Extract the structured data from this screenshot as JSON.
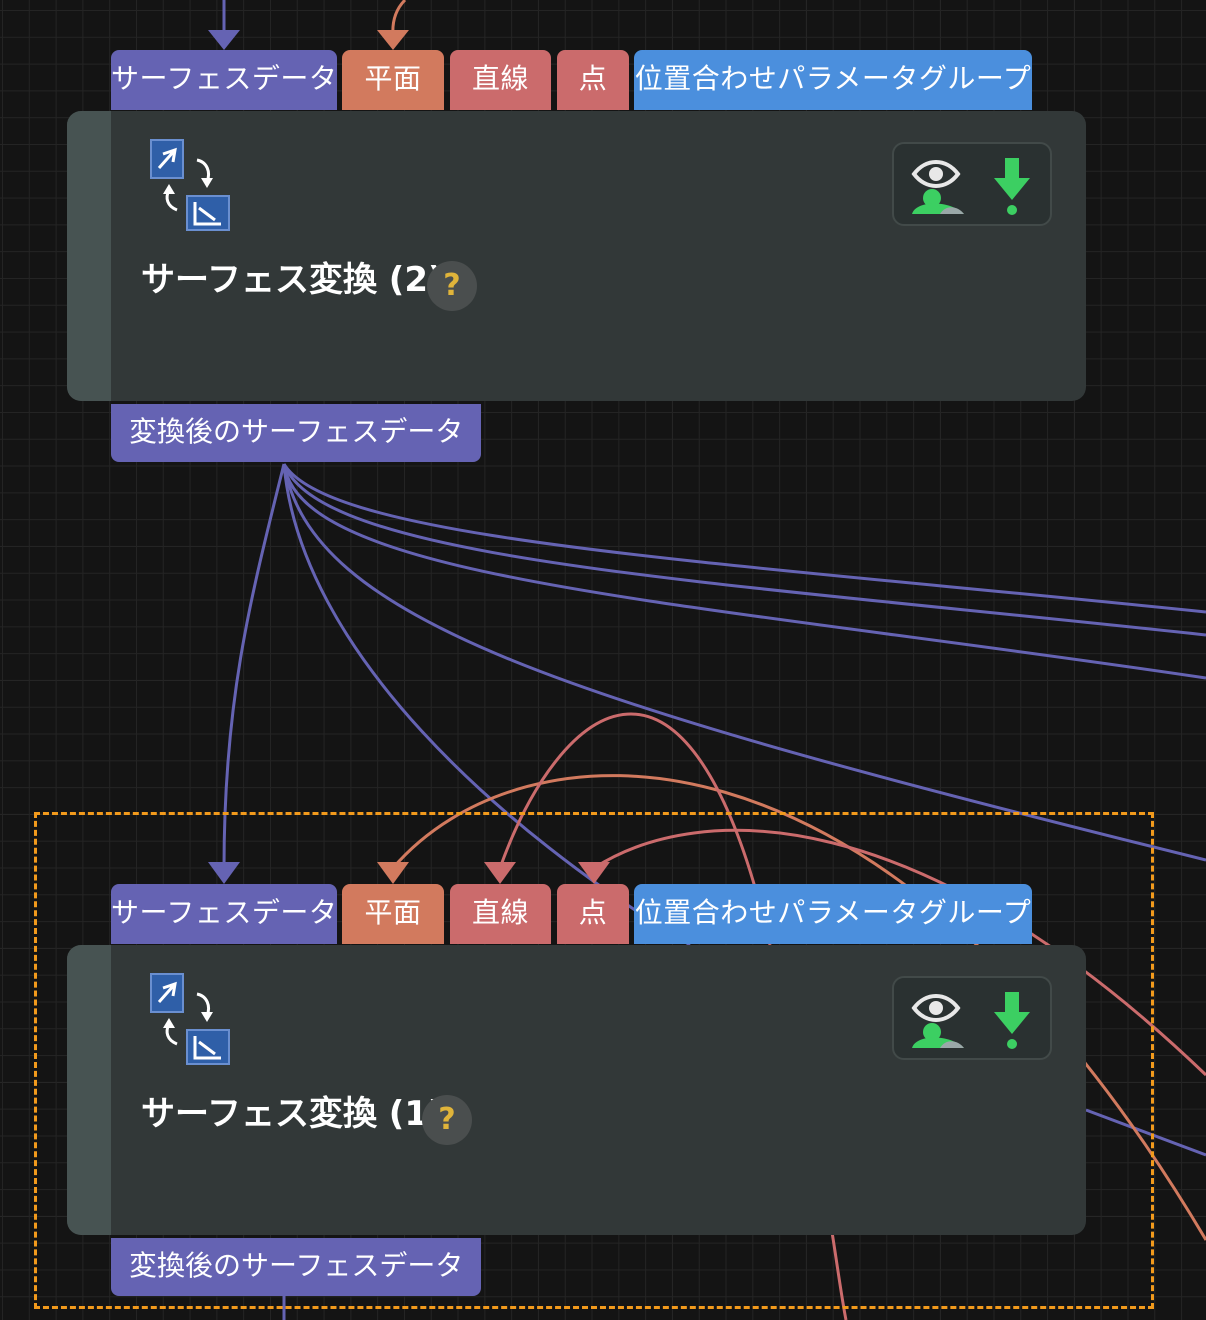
{
  "nodes": [
    {
      "title": "サーフェス変換 (2)",
      "inputs": {
        "surface": "サーフェスデータ",
        "plane": "平面",
        "line": "直線",
        "point": "点",
        "group": "位置合わせパラメータグループ"
      },
      "output": "変換後のサーフェスデータ",
      "help": "?",
      "selected": false
    },
    {
      "title": "サーフェス変換 (1)",
      "inputs": {
        "surface": "サーフェスデータ",
        "plane": "平面",
        "line": "直線",
        "point": "点",
        "group": "位置合わせパラメータグループ"
      },
      "output": "変換後のサーフェスデータ",
      "help": "?",
      "selected": true
    }
  ],
  "colors": {
    "surface_port": "#6563b3",
    "plane_port": "#d27a5e",
    "line_port": "#cb6b6c",
    "group_port": "#4b8fdd",
    "selection_outline": "#f29a1c",
    "help_mark": "#e0b43a",
    "action_icons": "#3ccf62"
  },
  "icons": {
    "node_icon": "surface-transform-icon",
    "preview": "eye-preview-icon",
    "output": "green-down-arrow-icon"
  }
}
